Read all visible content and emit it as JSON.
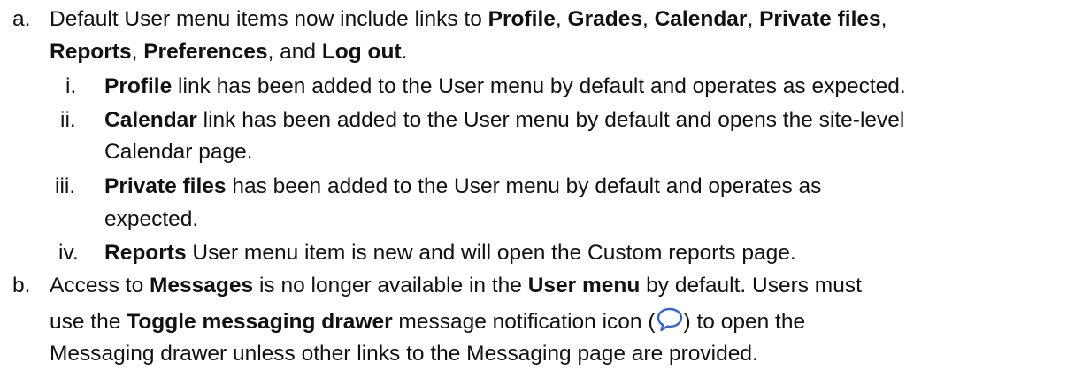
{
  "items": {
    "a": {
      "marker": "a.",
      "l1_pre": "Default User menu items now include links to ",
      "profile": "Profile",
      "comma1": ", ",
      "grades": "Grades",
      "comma2": ", ",
      "calendar": "Calendar",
      "comma3": ", ",
      "private_files": "Private files",
      "comma4": ",",
      "reports": "Reports",
      "comma5": ", ",
      "preferences": "Preferences",
      "and": ", and ",
      "logout": "Log out",
      "period": ".",
      "sub": {
        "i": {
          "marker": "i.",
          "bold": "Profile",
          "text": " link has been added to the User menu by default and operates as expected."
        },
        "ii": {
          "marker": "ii.",
          "bold": "Calendar",
          "text": " link has been added to the User menu by default and opens the site-level",
          "cont": "Calendar page."
        },
        "iii": {
          "marker": "iii.",
          "bold": "Private files",
          "text": " has been added to the User menu by default and operates as",
          "cont": "expected."
        },
        "iv": {
          "marker": "iv.",
          "bold": "Reports",
          "text": " User menu item is new and will open the Custom reports page."
        }
      }
    },
    "b": {
      "marker": "b.",
      "l1_pre": "Access to ",
      "messages": "Messages",
      "l1_mid": " is no longer available in the ",
      "user_menu": "User menu",
      "l1_post": " by default. Users must",
      "l2_pre": "use the ",
      "toggle": "Toggle messaging drawer",
      "l2_mid": " message notification icon (",
      "l2_post": ") to open the",
      "l3": "Messaging drawer unless other links to the Messaging page are provided."
    }
  },
  "icon": {
    "name": "speech-bubble-icon",
    "color": "#3366cc"
  }
}
